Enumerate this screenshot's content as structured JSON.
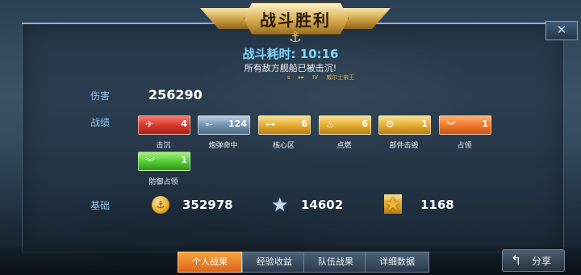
{
  "title": "战斗胜利",
  "battle_time": "战斗耗时: 10:16",
  "result_message": "所有敌方舰船已被击沉!",
  "ship": {
    "nation": "s",
    "class_icon": "ship-class-icon",
    "tier": "IV",
    "name": "威尔士亲王"
  },
  "damage": {
    "label": "伤害",
    "value": "256290"
  },
  "achievements": {
    "label": "战绩",
    "items": [
      {
        "caption": "击沉",
        "count": "4",
        "color": "red",
        "icon": "plane-icon"
      },
      {
        "caption": "炮弹命中",
        "count": "124",
        "color": "slate",
        "icon": "shell-icon"
      },
      {
        "caption": "核心区",
        "count": "6",
        "color": "gold",
        "icon": "citadel-icon"
      },
      {
        "caption": "点燃",
        "count": "6",
        "color": "gold",
        "icon": "fire-icon"
      },
      {
        "caption": "部件击毁",
        "count": "1",
        "color": "gold",
        "icon": "module-icon"
      },
      {
        "caption": "占领",
        "count": "1",
        "color": "orange",
        "icon": "chevron-icon"
      },
      {
        "caption": "防御占领",
        "count": "1",
        "color": "green",
        "icon": "chevron-icon"
      }
    ]
  },
  "base": {
    "label": "基础",
    "credits": "352978",
    "xp": "14602",
    "free_xp": "1168"
  },
  "tabs": [
    "个人战果",
    "经验收益",
    "队伍战果",
    "详细数据"
  ],
  "active_tab": 0,
  "share_label": "分享",
  "close_glyph": "✕"
}
